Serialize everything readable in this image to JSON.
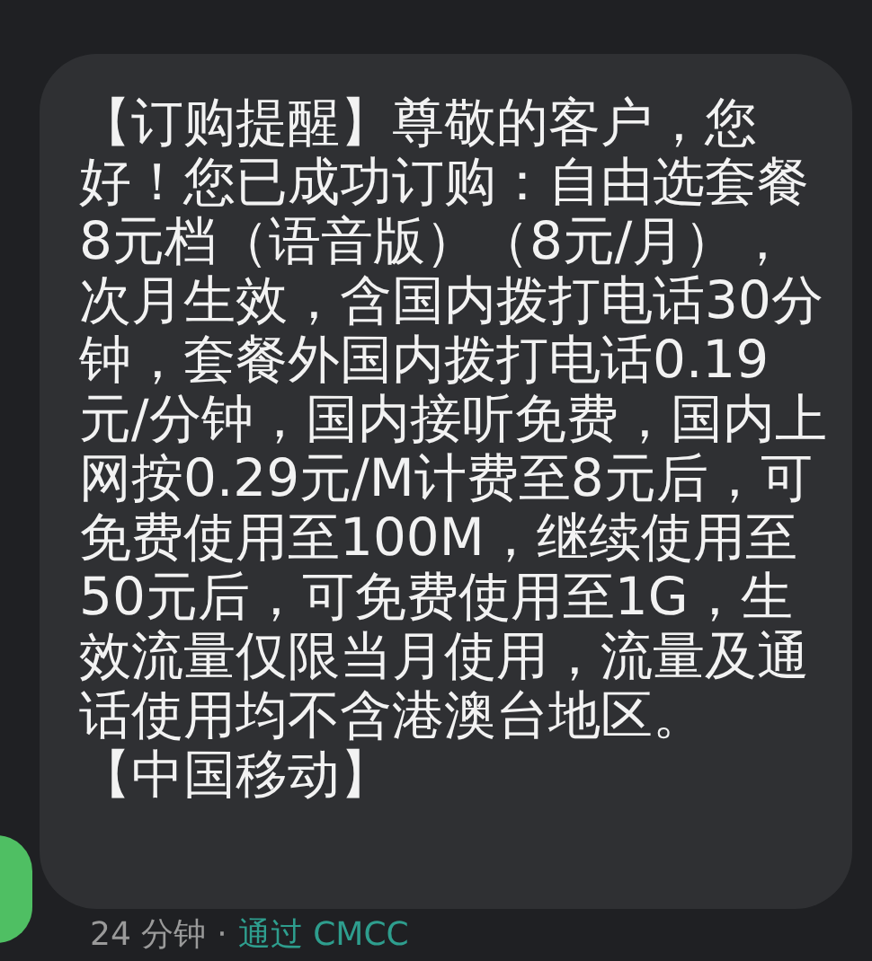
{
  "message": {
    "text": "【订购提醒】尊敬的客户，您好！您已成功订购：自由选套餐8元档（语音版）（8元/月），次月生效，含国内拨打电话30分钟，套餐外国内拨打电话0.19元/分钟，国内接听免费，国内上网按0.29元/M计费至8元后，可免费使用至100M，继续使用至50元后，可免费使用至1G，生效流量仅限当月使用，流量及通话使用均不含港澳台地区。",
    "signature": "【中国移动】"
  },
  "footer": {
    "time": "24 分钟",
    "separator": "·",
    "via": "通过 CMCC"
  }
}
